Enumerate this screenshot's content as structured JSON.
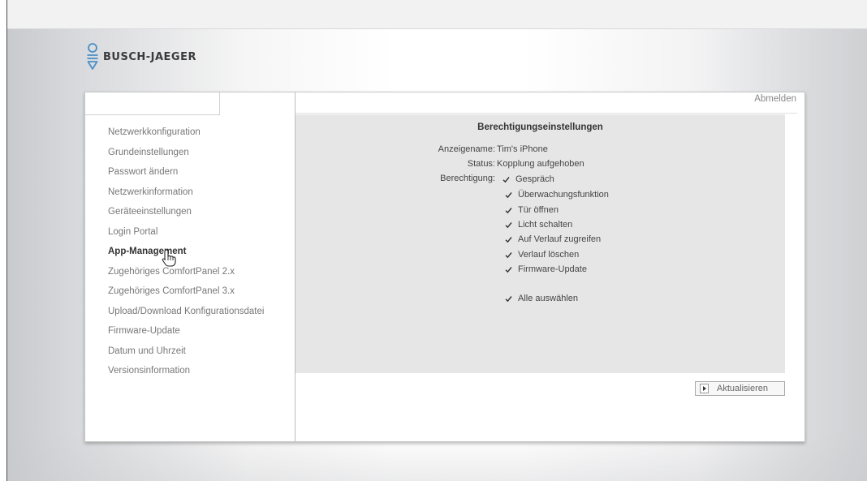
{
  "brand": {
    "name": "BUSCH-JAEGER",
    "icon": "busch-jaeger-logo-icon",
    "color": "#4a90c8"
  },
  "header": {
    "logout_label": "Abmelden"
  },
  "sidebar": {
    "items": [
      {
        "label": "Netzwerkkonfiguration"
      },
      {
        "label": "Grundeinstellungen"
      },
      {
        "label": "Passwort ändern"
      },
      {
        "label": "Netzwerkinformation"
      },
      {
        "label": "Geräteeinstellungen"
      },
      {
        "label": "Login Portal"
      },
      {
        "label": "App-Management"
      },
      {
        "label": "Zugehöriges ComfortPanel 2.x"
      },
      {
        "label": "Zugehöriges ComfortPanel 3.x"
      },
      {
        "label": "Upload/Download Konfigurationsdatei"
      },
      {
        "label": "Firmware-Update"
      },
      {
        "label": "Datum und Uhrzeit"
      },
      {
        "label": "Versionsinformation"
      }
    ],
    "active_index": 6
  },
  "main": {
    "title": "Berechtigungseinstellungen",
    "display_name_label": "Anzeigename:",
    "display_name_value": "Tim's iPhone",
    "status_label": "Status:",
    "status_value": "Kopplung aufgehoben",
    "permission_label": "Berechtigung:",
    "permissions": [
      {
        "label": "Gespräch",
        "checked": true
      },
      {
        "label": "Überwachungsfunktion",
        "checked": true
      },
      {
        "label": "Tür öffnen",
        "checked": true
      },
      {
        "label": "Licht schalten",
        "checked": true
      },
      {
        "label": "Auf Verlauf zugreifen",
        "checked": true
      },
      {
        "label": "Verlauf löschen",
        "checked": true
      },
      {
        "label": "Firmware-Update",
        "checked": true
      }
    ],
    "select_all": {
      "label": "Alle auswählen",
      "checked": true
    },
    "update_button": "Aktualisieren"
  }
}
